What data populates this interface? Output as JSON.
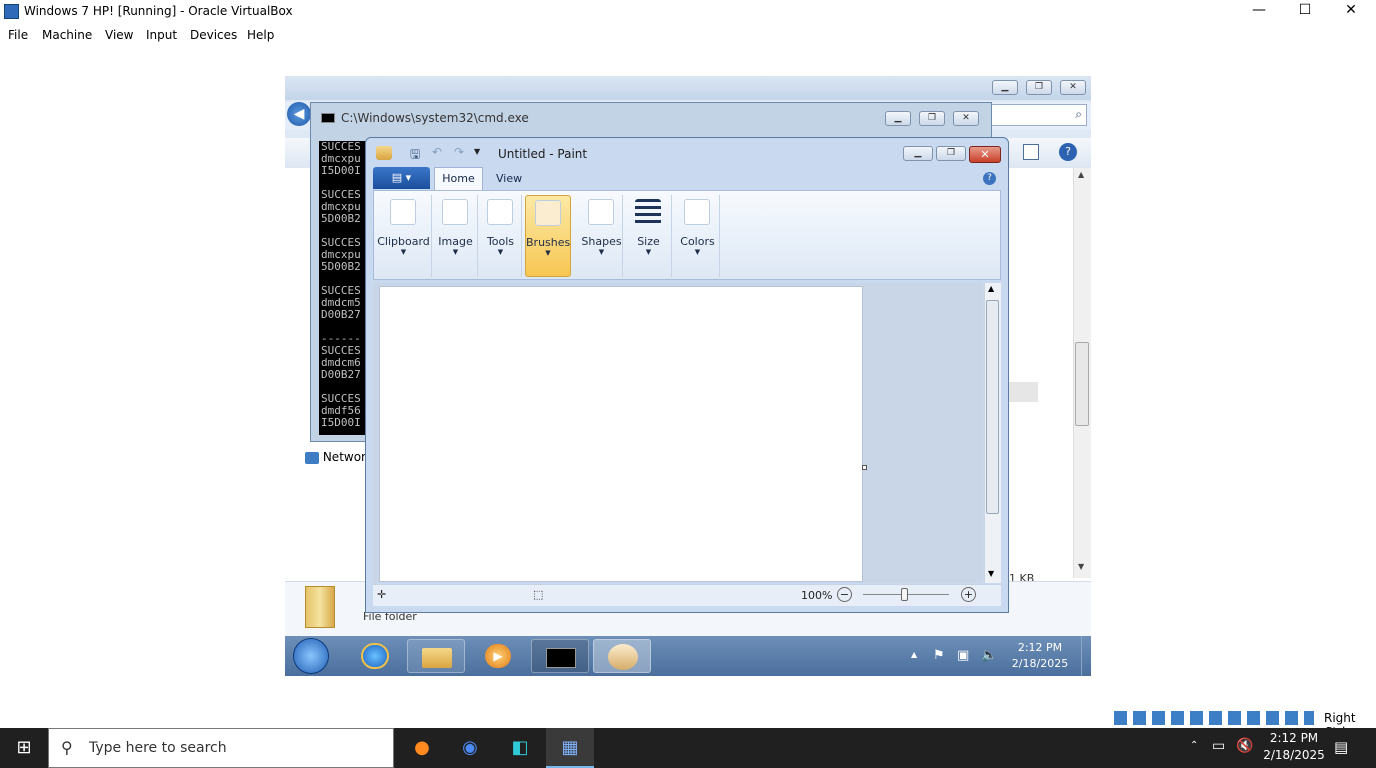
{
  "host": {
    "window_title": "Windows 7 HP! [Running] - Oracle VirtualBox",
    "controls": {
      "minimize": "—",
      "maximize": "☐",
      "close": "✕"
    },
    "menu": [
      "File",
      "Machine",
      "View",
      "Input",
      "Devices",
      "Help"
    ],
    "status_right": "Right Ctrl",
    "taskbar": {
      "search_placeholder": "Type here to search",
      "time": "2:12 PM",
      "date": "2/18/2025"
    }
  },
  "guest": {
    "explorer": {
      "network_label": "Networ",
      "size_text": "1 KB",
      "folder_type": "File folder"
    },
    "cmd": {
      "title": "C:\\Windows\\system32\\cmd.exe",
      "lines": [
        "SUCCES",
        "dmcxpu",
        "I5D00I",
        "",
        "SUCCES",
        "dmcxpu",
        "5D00B2",
        "",
        "SUCCES",
        "dmcxpu",
        "5D00B2",
        "",
        "SUCCES",
        "dmdcm5",
        "D00B27",
        "",
        "------",
        "SUCCES",
        "dmdcm6",
        "D00B27",
        "",
        "SUCCES",
        "dmdf56",
        "I5D00I"
      ]
    },
    "paint": {
      "title": "Untitled - Paint",
      "tabs": [
        "Home",
        "View"
      ],
      "groups": [
        "Clipboard",
        "Image",
        "Tools",
        "Brushes",
        "Shapes",
        "Size",
        "Colors"
      ],
      "zoom": "100%"
    },
    "taskbar": {
      "time": "2:12 PM",
      "date": "2/18/2025"
    }
  },
  "colors": {
    "paint_close": "#c8412b",
    "host_taskbar": "#202020",
    "guest_taskbar": "#4b6f9d"
  }
}
